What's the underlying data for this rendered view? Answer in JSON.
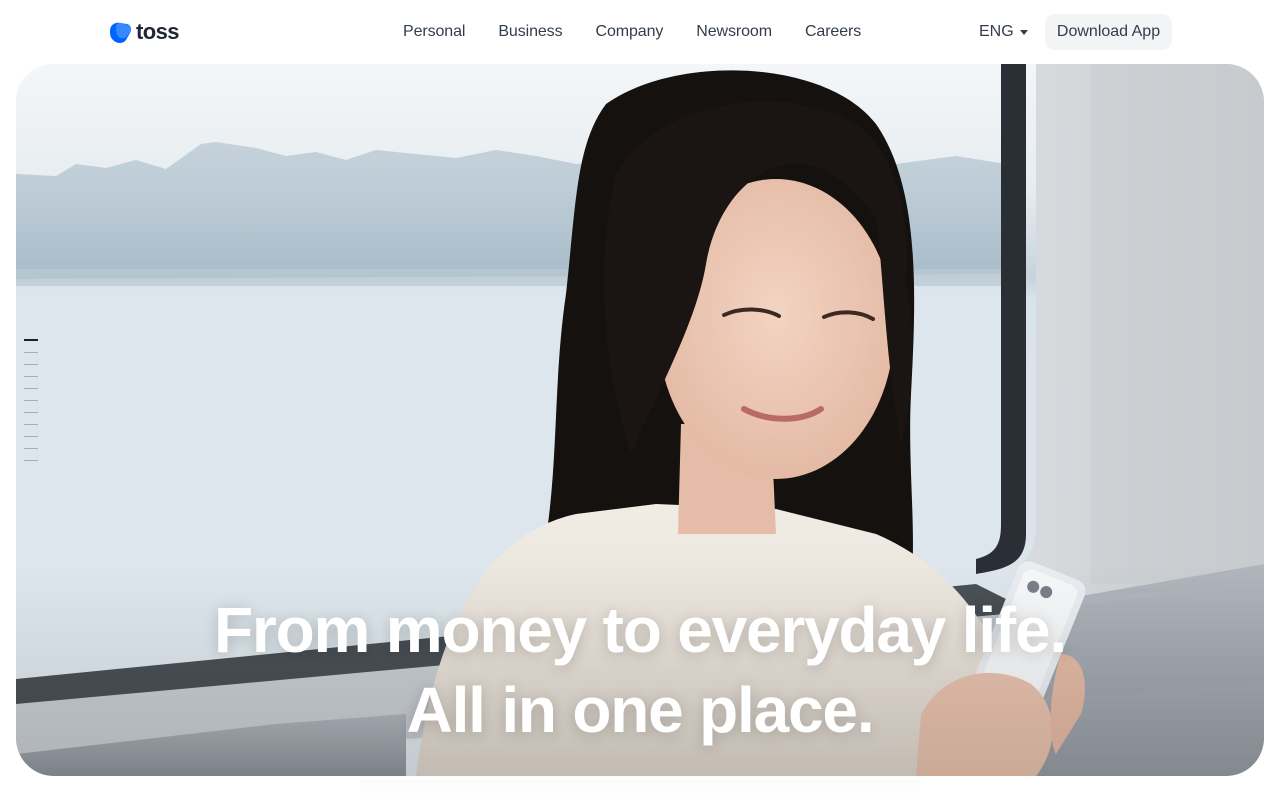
{
  "brand": {
    "name": "toss",
    "logo_icon": "toss-logo-icon",
    "logo_color": "#3182f6"
  },
  "nav": {
    "items": [
      {
        "label": "Personal"
      },
      {
        "label": "Business"
      },
      {
        "label": "Company"
      },
      {
        "label": "Newsroom"
      },
      {
        "label": "Careers"
      }
    ]
  },
  "language": {
    "current": "ENG",
    "icon": "caret-down-icon"
  },
  "download_button": {
    "label": "Download App"
  },
  "hero": {
    "image": "woman-reading-phone-on-train-photo",
    "headline_line1": "From money to everyday life.",
    "headline_line2": "All in one place.",
    "pager": {
      "total": 11,
      "active": 1
    }
  }
}
